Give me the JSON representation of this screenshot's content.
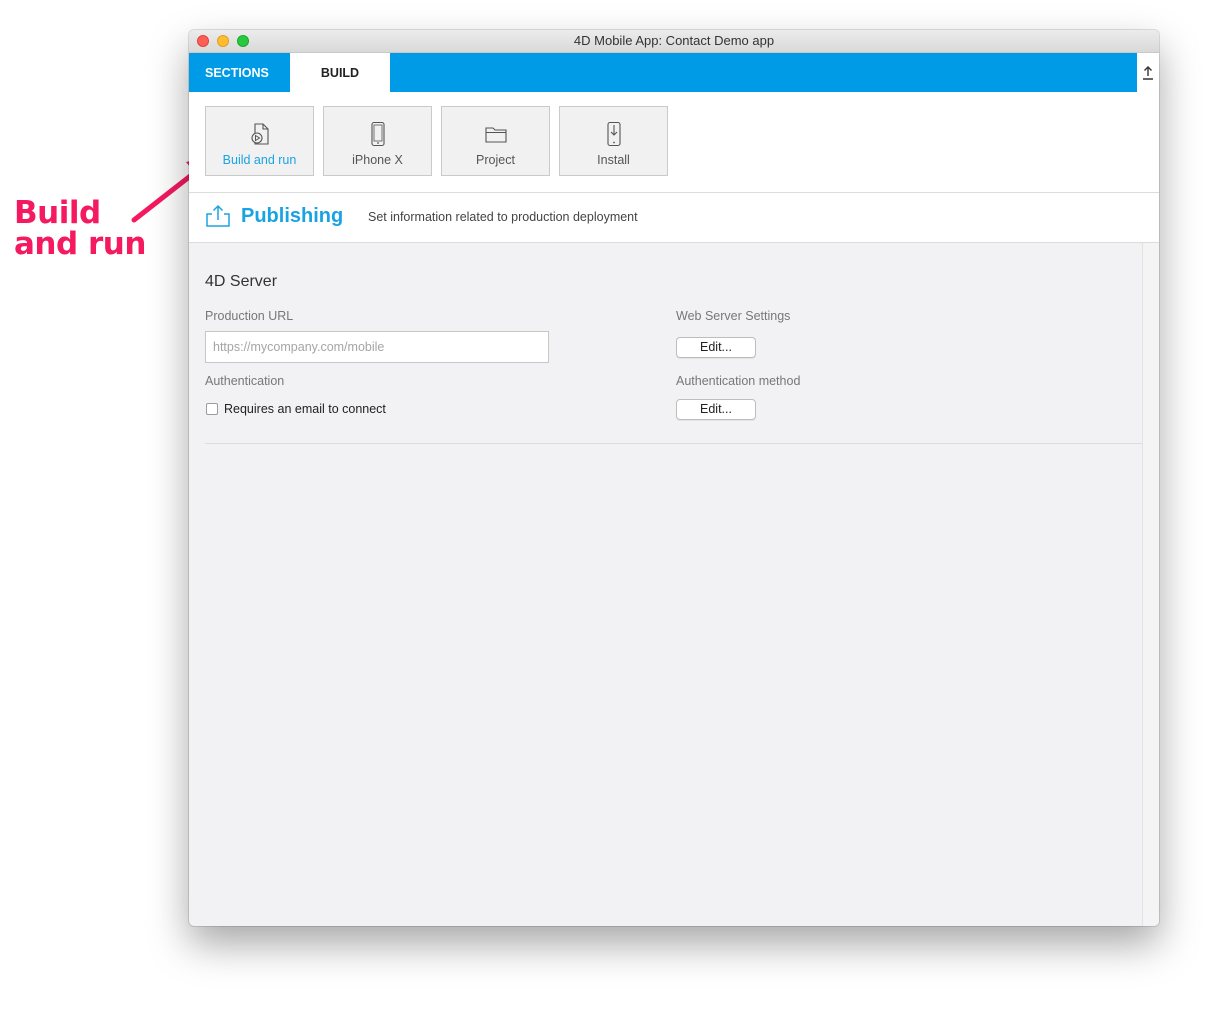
{
  "annotation": {
    "line1": "Build",
    "line2": "and run",
    "color": "#f5195f"
  },
  "window": {
    "title": "4D Mobile App: Contact Demo app"
  },
  "tabs": {
    "sections": "SECTIONS",
    "build": "BUILD"
  },
  "toolbar": {
    "buttons": [
      {
        "label": "Build and run",
        "icon": "build-run-icon",
        "active": true
      },
      {
        "label": "iPhone X",
        "icon": "iphone-icon",
        "active": false
      },
      {
        "label": "Project",
        "icon": "folder-icon",
        "active": false
      },
      {
        "label": "Install",
        "icon": "install-icon",
        "active": false
      }
    ]
  },
  "header": {
    "title": "Publishing",
    "subtitle": "Set information related to production deployment"
  },
  "server": {
    "title": "4D Server",
    "production_url_label": "Production URL",
    "production_url_value": "",
    "production_url_placeholder": "https://mycompany.com/mobile",
    "web_server_label": "Web Server Settings",
    "edit_label": "Edit...",
    "authentication_label": "Authentication",
    "auth_method_label": "Authentication method",
    "requires_email_label": "Requires an email to connect",
    "requires_email_checked": false
  },
  "colors": {
    "accent": "#009be6",
    "accent_text": "#1aa3e3"
  }
}
